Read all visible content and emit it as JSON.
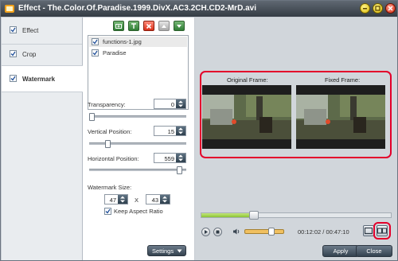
{
  "window": {
    "title": "Effect - The.Color.Of.Paradise.1999.DivX.AC3.2CH.CD2-MrD.avi"
  },
  "tabs": [
    {
      "label": "Effect",
      "checked": true,
      "active": false
    },
    {
      "label": "Crop",
      "checked": true,
      "active": false
    },
    {
      "label": "Watermark",
      "checked": true,
      "active": true
    }
  ],
  "watermark": {
    "toolbar_icons": [
      "add-image-icon",
      "add-text-icon",
      "delete-icon",
      "move-up-icon",
      "move-down-icon"
    ],
    "items": [
      {
        "label": "functions-1.jpg",
        "checked": true,
        "selected": true
      },
      {
        "label": "Paradise",
        "checked": true,
        "selected": false
      }
    ],
    "transparency": {
      "label": "Transparency:",
      "value": "0",
      "level": 0
    },
    "vertical_position": {
      "label": "Vertical Position:",
      "value": "15",
      "level": 15
    },
    "horizontal_position": {
      "label": "Horizontal Position:",
      "value": "559",
      "level": 95
    },
    "size": {
      "label": "Watermark Size:",
      "width": "47",
      "height": "43",
      "separator": "X"
    },
    "keep_aspect": {
      "label": "Keep Aspect Ratio",
      "checked": true
    },
    "settings_label": "Settings"
  },
  "preview": {
    "original_label": "Original Frame:",
    "fixed_label": "Fixed Frame:",
    "progress_fraction": 0.25,
    "volume_fraction": 0.7,
    "time": "00:12:02 / 00:47:10"
  },
  "footer": {
    "apply_label": "Apply",
    "close_label": "Close"
  },
  "colors": {
    "highlight_red": "#e3002b",
    "progress_green": "#8ac236"
  }
}
